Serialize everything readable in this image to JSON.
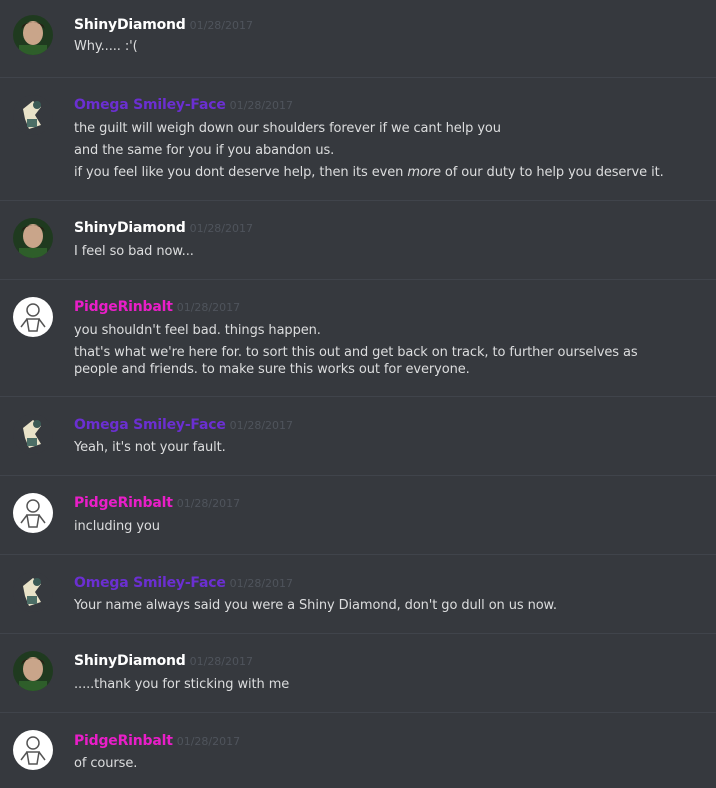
{
  "colors": {
    "ShinyDiamond": "#ffffff",
    "Omega Smiley-Face": "#6b2fd1",
    "PidgeRinbalt": "#e91ec8"
  },
  "messages": [
    {
      "author": "ShinyDiamond",
      "timestamp": "01/28/2017",
      "avatar": "shinydiamond-avatar",
      "lines": [
        "Why..... :'("
      ]
    },
    {
      "author": "Omega Smiley-Face",
      "timestamp": "01/28/2017",
      "avatar": "omega-avatar",
      "lines": [
        "the guilt will weigh down our shoulders forever if we cant help you",
        "and the same for you if you abandon us.",
        "if you feel like you dont deserve help, then its even more of our duty to help you deserve it."
      ]
    },
    {
      "author": "ShinyDiamond",
      "timestamp": "01/28/2017",
      "avatar": "shinydiamond-avatar",
      "lines": [
        "I feel so bad now..."
      ]
    },
    {
      "author": "PidgeRinbalt",
      "timestamp": "01/28/2017",
      "avatar": "pidge-avatar",
      "lines": [
        "you shouldn't feel bad. things happen.",
        "that's what we're here for. to sort this out and get back on track, to further ourselves as people and friends. to make sure this works out for everyone."
      ]
    },
    {
      "author": "Omega Smiley-Face",
      "timestamp": "01/28/2017",
      "avatar": "omega-avatar",
      "lines": [
        "Yeah, it's not your fault."
      ]
    },
    {
      "author": "PidgeRinbalt",
      "timestamp": "01/28/2017",
      "avatar": "pidge-avatar",
      "lines": [
        "including you"
      ]
    },
    {
      "author": "Omega Smiley-Face",
      "timestamp": "01/28/2017",
      "avatar": "omega-avatar",
      "lines": [
        "Your name always said you were a Shiny Diamond, don't go dull on us now."
      ]
    },
    {
      "author": "ShinyDiamond",
      "timestamp": "01/28/2017",
      "avatar": "shinydiamond-avatar",
      "lines": [
        ".....thank you for sticking with me"
      ]
    },
    {
      "author": "PidgeRinbalt",
      "timestamp": "01/28/2017",
      "avatar": "pidge-avatar",
      "lines": [
        "of course."
      ]
    }
  ]
}
